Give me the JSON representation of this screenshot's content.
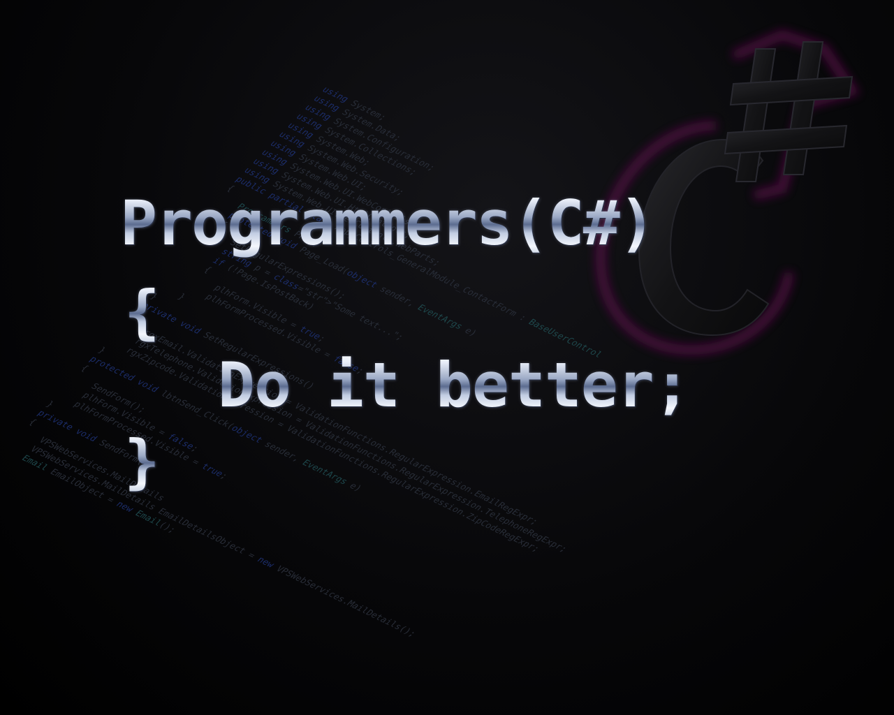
{
  "wallpaper": {
    "headline": "Programmers(C#)",
    "open_brace": "{",
    "statement": "Do it better;",
    "close_brace": "}"
  },
  "logo": {
    "icon": "csharp-logo-icon",
    "label": "C#",
    "glow_color": "#5a0a4a"
  },
  "background_code": {
    "lines": [
      "using System;",
      "using System.Data;",
      "using System.Configuration;",
      "using System.Collections;",
      "using System.Web;",
      "using System.Web.Security;",
      "using System.Web.UI;",
      "using System.Web.UI.WebControls;",
      "using System.Web.UI.HtmlControls;",
      "using System.Web.UI.WebControls.WebParts;",
      "public partial class App_Controls_GeneralModule_ContactForm : BaseUserControl",
      "{",
      "    Programmers PPLE;",
      "    protected void Page_Load(object sender, EventArgs e)",
      "    {",
      "        SetRegularExpressions();",
      "        string p = \"Some text...\";",
      "        if (!Page.IsPostBack)",
      "        {",
      "            plhForm.Visible = true;",
      "            plhFormProcessed.Visible = false;",
      "        }",
      "    }",
      "    private void SetRegularExpressions()",
      "    {",
      "        rgxEmail.ValidationExpression = ValidationFunctions.RegularExpression.EmailRegExpr;",
      "        rgxTelephone.ValidationExpression = ValidationFunctions.RegularExpression.TelephoneRegExpr;",
      "        rgxZipcode.ValidationExpression = ValidationFunctions.RegularExpression.ZipCodeRegExpr;",
      "    }",
      "    protected void lbtnSend_Click(object sender, EventArgs e)",
      "    {",
      "        SendForm();",
      "        plhForm.Visible = false;",
      "        plhFormProcessed.Visible = true;",
      "    }",
      "    private void SendForm()",
      "    {",
      "        VPSWebServices.MailDetails",
      "        VPSWebServices.MailDetails EmailDetailsObject = new VPSWebServices.MailDetails();",
      "        Email EmailObject = new Email();"
    ]
  },
  "colors": {
    "background": "#000000",
    "chrome_light": "#f4f7fc",
    "chrome_dark": "#5c6c90",
    "code_keyword": "#1d2f6e",
    "code_type": "#1f4a4e"
  }
}
